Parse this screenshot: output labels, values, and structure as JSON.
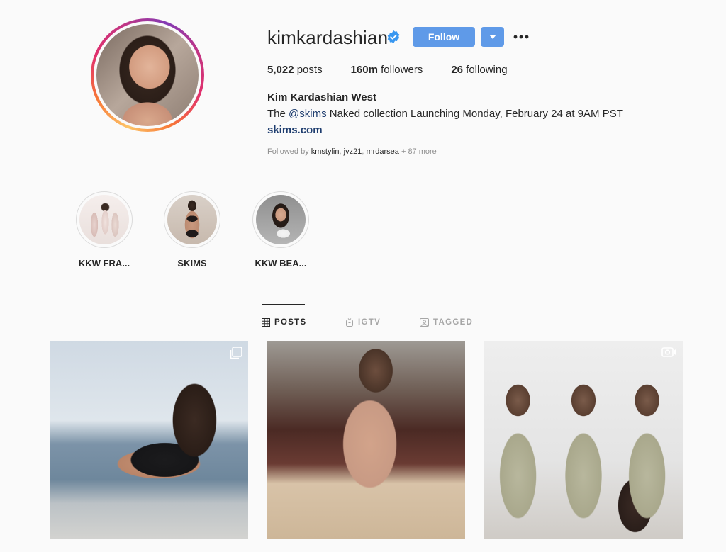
{
  "profile": {
    "username": "kimkardashian",
    "verified": true,
    "follow_label": "Follow",
    "stats": {
      "posts_value": "5,022",
      "posts_label": "posts",
      "followers_value": "160m",
      "followers_label": "followers",
      "following_value": "26",
      "following_label": "following"
    },
    "full_name": "Kim Kardashian West",
    "bio_prefix": "The ",
    "bio_mention": "@skims",
    "bio_suffix": " Naked collection Launching Monday, February 24 at 9AM PST",
    "link": "skims.com",
    "followed_by": {
      "prefix": "Followed by ",
      "users": [
        "kmstylin",
        "jvz21",
        "mrdarsea"
      ],
      "more": " + 87 more"
    }
  },
  "highlights": [
    {
      "label": "KKW FRA..."
    },
    {
      "label": "SKIMS"
    },
    {
      "label": "KKW BEA..."
    }
  ],
  "tabs": [
    {
      "label": "POSTS",
      "icon": "grid-icon",
      "active": true
    },
    {
      "label": "IGTV",
      "icon": "igtv-icon",
      "active": false
    },
    {
      "label": "TAGGED",
      "icon": "tagged-icon",
      "active": false
    }
  ],
  "posts": [
    {
      "badge": "carousel-icon"
    },
    {
      "badge": ""
    },
    {
      "badge": "video-icon"
    }
  ],
  "colors": {
    "accent": "#5f9ae8",
    "link": "#1d3c6e",
    "background": "#fafafa",
    "verified": "#3897f0"
  }
}
